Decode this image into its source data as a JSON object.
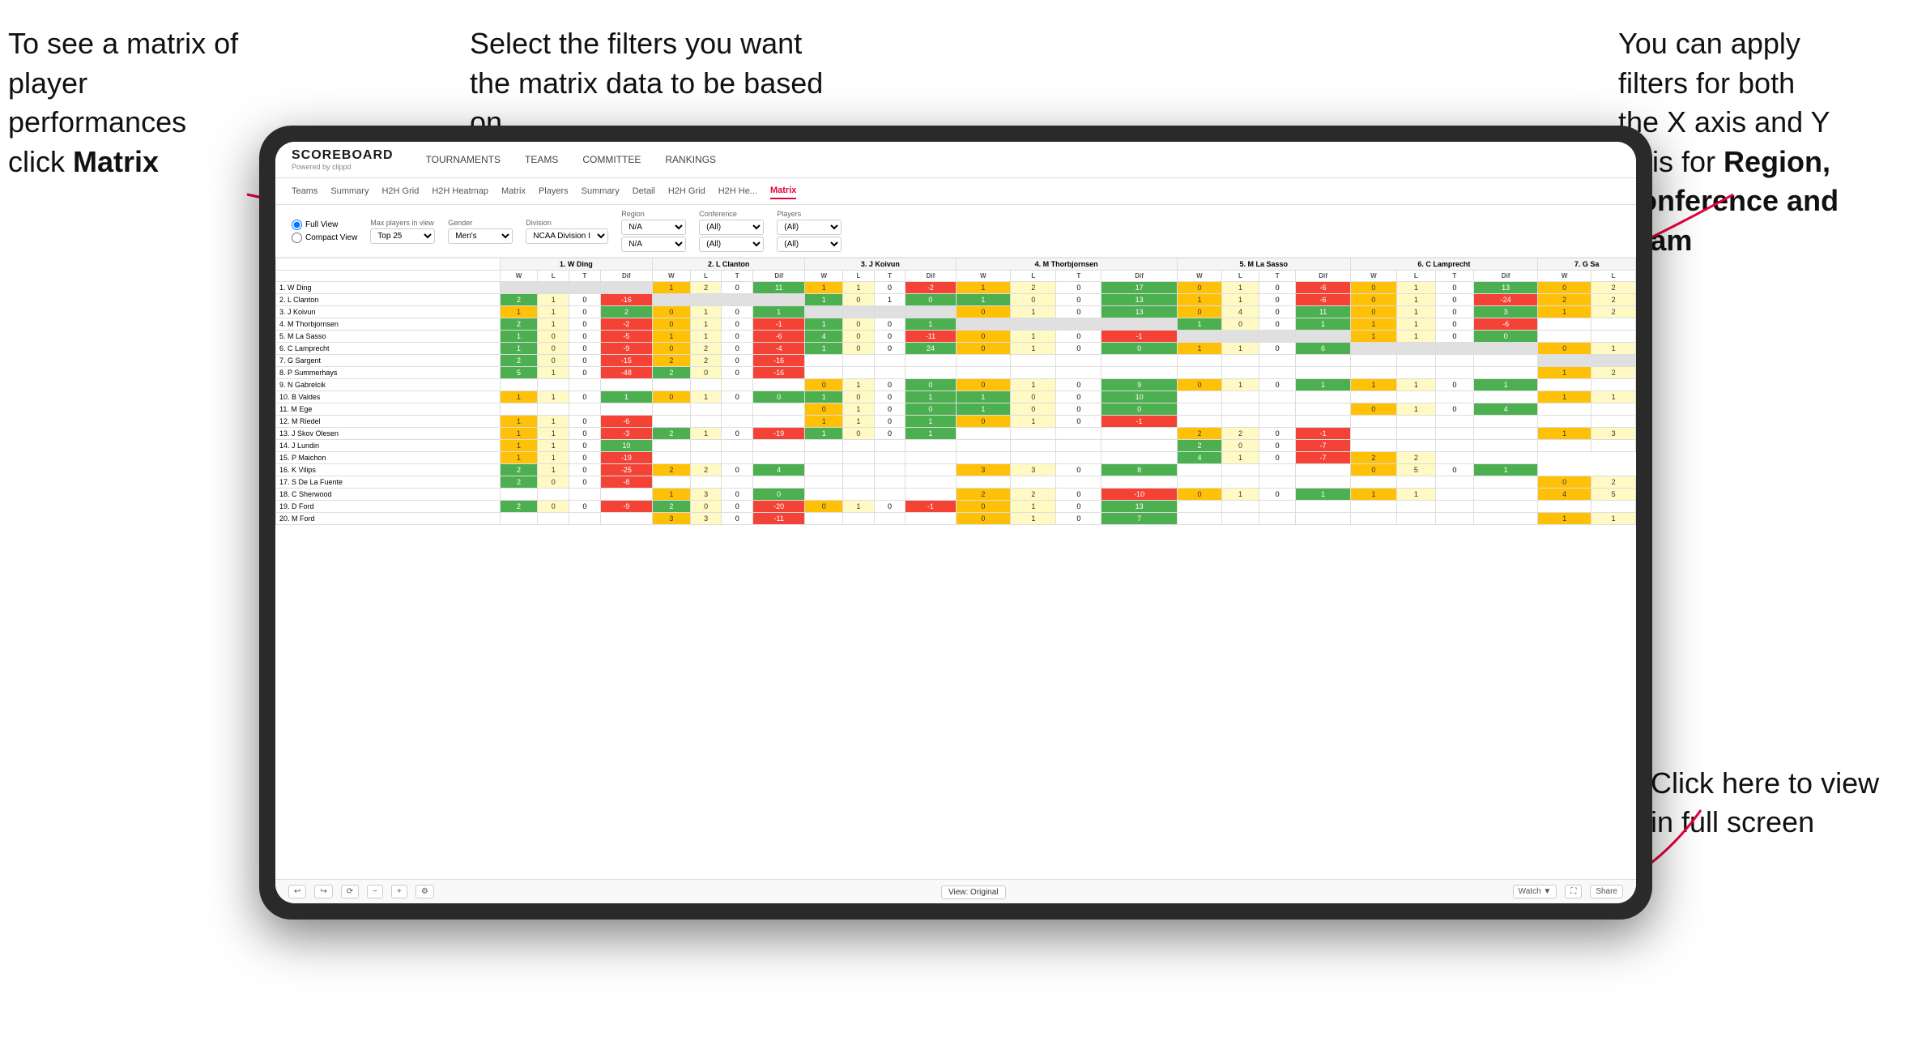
{
  "annotations": {
    "top_left": {
      "line1": "To see a matrix of",
      "line2": "player performances",
      "line3": "click ",
      "bold": "Matrix"
    },
    "top_center": {
      "text": "Select the filters you want the matrix data to be based on"
    },
    "top_right": {
      "line1": "You  can apply",
      "line2": "filters for both",
      "line3": "the X axis and Y",
      "line4": "Axis for ",
      "bold1": "Region,",
      "line5": "",
      "bold2": "Conference and",
      "bold3": "Team"
    },
    "bottom_right": {
      "line1": "Click here to view",
      "line2": "in full screen"
    }
  },
  "app": {
    "logo": {
      "title": "SCOREBOARD",
      "sub": "Powered by clippd"
    },
    "nav_items": [
      "TOURNAMENTS",
      "TEAMS",
      "COMMITTEE",
      "RANKINGS"
    ],
    "sub_tabs": [
      "Teams",
      "Summary",
      "H2H Grid",
      "H2H Heatmap",
      "Matrix",
      "Players",
      "Summary",
      "Detail",
      "H2H Grid",
      "H2H He...",
      "Matrix"
    ],
    "active_tab": "Matrix",
    "filters": {
      "view_options": [
        "Full View",
        "Compact View"
      ],
      "max_players_label": "Max players in view",
      "max_players_value": "Top 25",
      "gender_label": "Gender",
      "gender_value": "Men's",
      "division_label": "Division",
      "division_value": "NCAA Division I",
      "region_label": "Region",
      "region_value": "N/A",
      "conference_label": "Conference",
      "conference_value": "(All)",
      "players_label": "Players",
      "players_value": "(All)"
    },
    "matrix": {
      "col_headers": [
        "1. W Ding",
        "2. L Clanton",
        "3. J Koivun",
        "4. M Thorbjornsen",
        "5. M La Sasso",
        "6. C Lamprecht",
        "7. G Sa"
      ],
      "sub_cols": [
        "W",
        "L",
        "T",
        "Dif"
      ],
      "rows": [
        {
          "name": "1. W Ding",
          "cells": [
            [
              null,
              null
            ],
            [
              1,
              2,
              0,
              11
            ],
            [
              1,
              1,
              0,
              -2
            ],
            [
              1,
              2,
              0,
              17
            ],
            [
              0,
              1,
              0,
              -6
            ],
            [
              0,
              1,
              0,
              13
            ],
            [
              0,
              2
            ]
          ]
        },
        {
          "name": "2. L Clanton",
          "cells": [
            [
              2,
              1,
              0,
              -16
            ],
            [
              null,
              null
            ],
            [
              1,
              0,
              1,
              0
            ],
            [
              1,
              0,
              0,
              13
            ],
            [
              1,
              1,
              0,
              -6
            ],
            [
              0,
              1,
              0,
              -24
            ],
            [
              2,
              2
            ]
          ]
        },
        {
          "name": "3. J Koivun",
          "cells": [
            [
              1,
              1,
              0,
              2
            ],
            [
              0,
              1,
              0,
              1
            ],
            [
              null,
              null
            ],
            [
              0,
              1,
              0,
              13
            ],
            [
              0,
              4,
              0,
              11
            ],
            [
              0,
              1,
              0,
              3
            ],
            [
              1,
              2
            ]
          ]
        },
        {
          "name": "4. M Thorbjornsen",
          "cells": [
            [
              2,
              1,
              0,
              -2
            ],
            [
              0,
              1,
              0,
              -1
            ],
            [
              1,
              0,
              0,
              1
            ],
            [
              null,
              null
            ],
            [
              1,
              0,
              0,
              1
            ],
            [
              1,
              1,
              0,
              -6
            ],
            [
              null
            ]
          ]
        },
        {
          "name": "5. M La Sasso",
          "cells": [
            [
              1,
              0,
              0,
              -5
            ],
            [
              1,
              1,
              0,
              -6
            ],
            [
              4,
              0,
              0,
              -11
            ],
            [
              0,
              1,
              0,
              -1
            ],
            [
              null,
              null
            ],
            [
              1,
              1,
              0,
              0
            ],
            [
              null
            ]
          ]
        },
        {
          "name": "6. C Lamprecht",
          "cells": [
            [
              1,
              0,
              0,
              -9
            ],
            [
              0,
              2,
              0,
              -4
            ],
            [
              1,
              0,
              0,
              24
            ],
            [
              0,
              1,
              0,
              0
            ],
            [
              1,
              1,
              0,
              6
            ],
            [
              null,
              null
            ],
            [
              0,
              1
            ]
          ]
        },
        {
          "name": "7. G Sargent",
          "cells": [
            [
              2,
              0,
              0,
              -15
            ],
            [
              2,
              2,
              0,
              -16
            ],
            [
              null
            ],
            [
              null
            ],
            [
              null
            ],
            [
              null
            ],
            [
              null
            ]
          ]
        },
        {
          "name": "8. P Summerhays",
          "cells": [
            [
              5,
              1,
              0,
              -48
            ],
            [
              2,
              0,
              0,
              -16
            ],
            [
              null
            ],
            [
              null
            ],
            [
              null
            ],
            [
              null
            ],
            [
              1,
              2
            ]
          ]
        },
        {
          "name": "9. N Gabrelcik",
          "cells": [
            [
              null
            ],
            [
              null
            ],
            [
              0,
              1,
              0,
              0
            ],
            [
              0,
              1,
              0,
              9
            ],
            [
              0,
              1,
              0,
              1
            ],
            [
              1,
              1,
              0,
              1
            ],
            [
              null
            ]
          ]
        },
        {
          "name": "10. B Valdes",
          "cells": [
            [
              1,
              1,
              0,
              1
            ],
            [
              0,
              1,
              0,
              0
            ],
            [
              1,
              0,
              0,
              1
            ],
            [
              1,
              0,
              0,
              10
            ],
            [
              null
            ],
            [
              null
            ],
            [
              1,
              1
            ]
          ]
        },
        {
          "name": "11. M Ege",
          "cells": [
            [
              null
            ],
            [
              null
            ],
            [
              0,
              1,
              0,
              0
            ],
            [
              1,
              0,
              0,
              0
            ],
            [
              null
            ],
            [
              0,
              1,
              0,
              4
            ],
            [
              null
            ]
          ]
        },
        {
          "name": "12. M Riedel",
          "cells": [
            [
              1,
              1,
              0,
              -6
            ],
            [
              null
            ],
            [
              1,
              1,
              0,
              1
            ],
            [
              0,
              1,
              0,
              -1
            ],
            [
              null
            ],
            [
              null
            ],
            [
              null
            ]
          ]
        },
        {
          "name": "13. J Skov Olesen",
          "cells": [
            [
              1,
              1,
              0,
              -3
            ],
            [
              2,
              1,
              0,
              -19
            ],
            [
              1,
              0,
              0,
              1
            ],
            [
              null
            ],
            [
              2,
              2,
              0,
              -1
            ],
            [
              null
            ],
            [
              1,
              3
            ]
          ]
        },
        {
          "name": "14. J Lundin",
          "cells": [
            [
              1,
              1,
              0,
              10
            ],
            [
              null
            ],
            [
              null
            ],
            [
              null
            ],
            [
              2,
              0,
              0,
              -7
            ],
            [
              null
            ],
            [
              null
            ]
          ]
        },
        {
          "name": "15. P Maichon",
          "cells": [
            [
              1,
              1,
              0,
              -19
            ],
            [
              null
            ],
            [
              null
            ],
            [
              null
            ],
            [
              4,
              1,
              0,
              -7
            ],
            [
              2,
              2
            ]
          ]
        },
        {
          "name": "16. K Vilips",
          "cells": [
            [
              2,
              1,
              0,
              -25
            ],
            [
              2,
              2,
              0,
              4
            ],
            [
              null
            ],
            [
              3,
              3,
              0,
              8
            ],
            [
              null
            ],
            [
              0,
              5,
              0,
              1
            ]
          ]
        },
        {
          "name": "17. S De La Fuente",
          "cells": [
            [
              2,
              0,
              0,
              -8
            ],
            [
              null
            ],
            [
              null
            ],
            [
              null
            ],
            [
              null
            ],
            [
              null
            ],
            [
              0,
              2
            ]
          ]
        },
        {
          "name": "18. C Sherwood",
          "cells": [
            [
              null
            ],
            [
              1,
              3,
              0,
              0
            ],
            [
              null
            ],
            [
              2,
              2,
              0,
              -10
            ],
            [
              0,
              1,
              0,
              1
            ],
            [
              1,
              1
            ],
            [
              4,
              5
            ]
          ]
        },
        {
          "name": "19. D Ford",
          "cells": [
            [
              2,
              0,
              0,
              -9
            ],
            [
              2,
              0,
              0,
              -20
            ],
            [
              0,
              1,
              0,
              -1
            ],
            [
              0,
              1,
              0,
              13
            ],
            [
              null
            ],
            [
              null
            ],
            [
              null
            ]
          ]
        },
        {
          "name": "20. M Ford",
          "cells": [
            [
              null
            ],
            [
              3,
              3,
              0,
              -11
            ],
            [
              null
            ],
            [
              0,
              1,
              0,
              7
            ],
            [
              null
            ],
            [
              null
            ],
            [
              1,
              1
            ]
          ]
        }
      ]
    },
    "toolbar": {
      "view_original": "View: Original",
      "watch": "Watch ▼",
      "share": "Share"
    }
  }
}
